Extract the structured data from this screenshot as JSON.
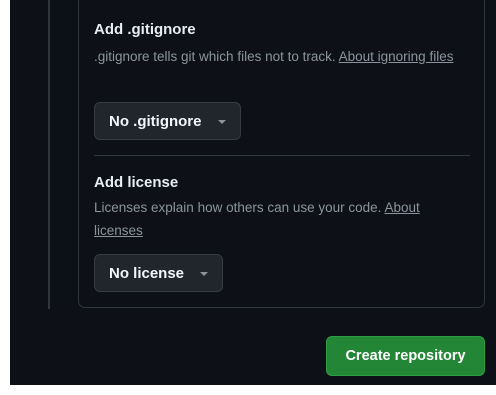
{
  "gitignore": {
    "title": "Add .gitignore",
    "description": ".gitignore tells git which files not to track. ",
    "link_text": "About ignoring files",
    "dropdown_value": "No .gitignore"
  },
  "license": {
    "title": "Add license",
    "description": "Licenses explain how others can use your code. ",
    "link_text": "About licenses",
    "dropdown_value": "No license"
  },
  "actions": {
    "create_label": "Create repository"
  },
  "colors": {
    "background": "#0d1117",
    "border": "#30363d",
    "primary_button": "#238636",
    "text_primary": "#e6edf3",
    "text_muted": "#8b949e"
  },
  "icons": {
    "dropdown_caret": "triangle-down-icon"
  }
}
